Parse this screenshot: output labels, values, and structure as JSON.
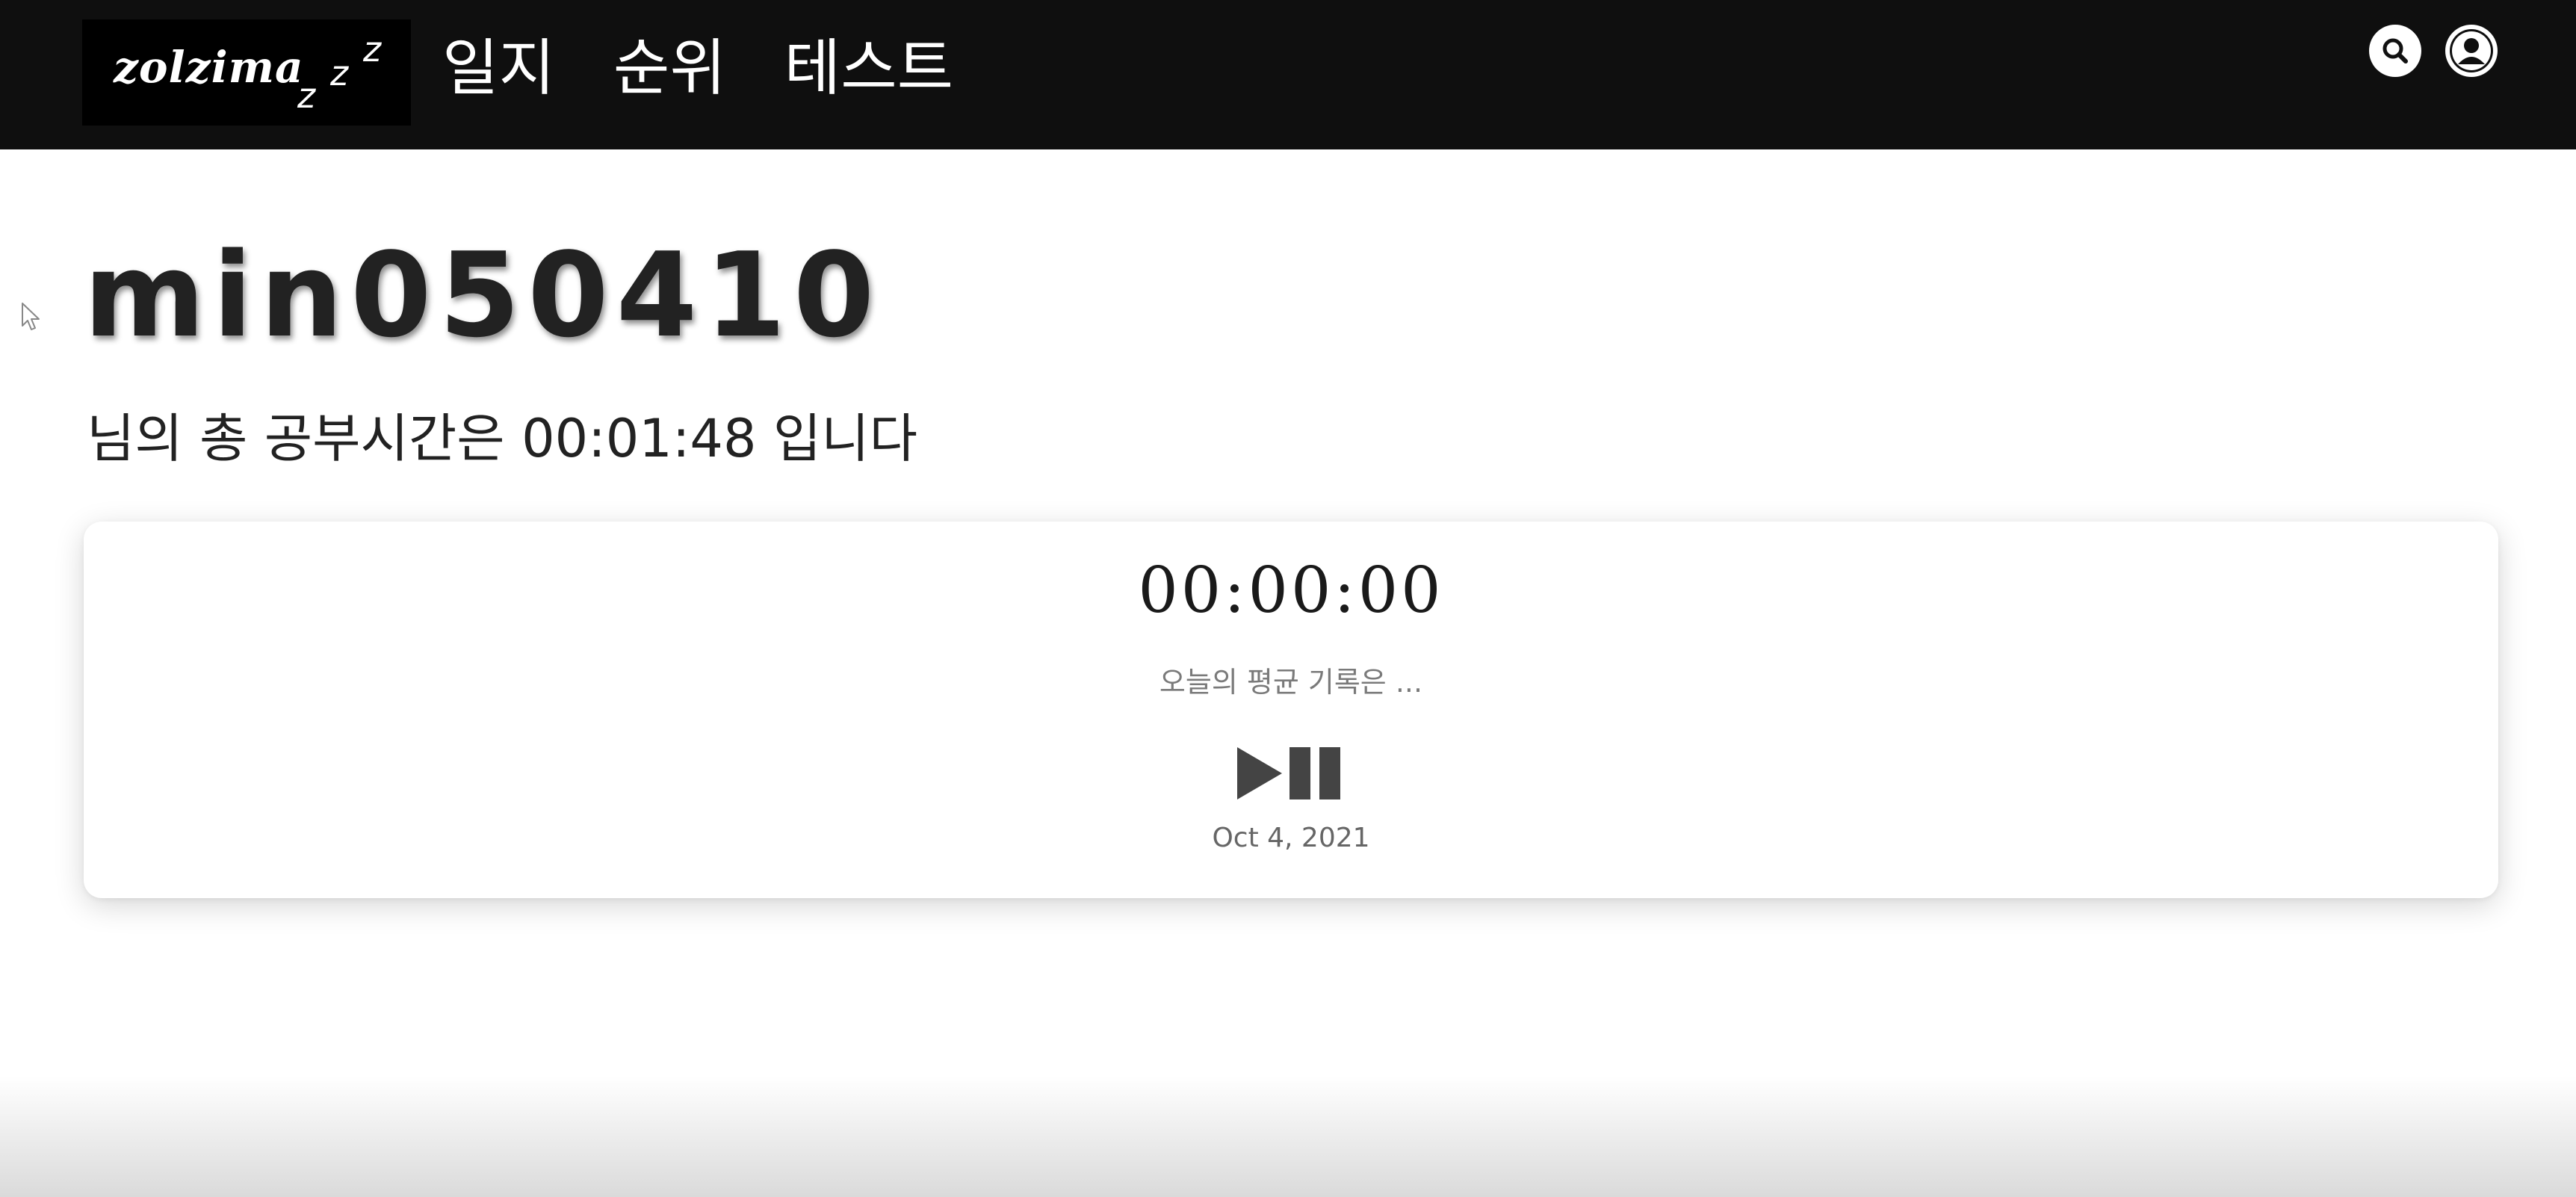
{
  "navbar": {
    "logo": {
      "text": "zolzima",
      "zzz": [
        "z",
        "z",
        "z"
      ]
    },
    "links": [
      "일지",
      "순위",
      "테스트"
    ],
    "icons": [
      "search-icon",
      "user-icon"
    ]
  },
  "profile": {
    "username": "min050410",
    "total_prefix": "님의 총 공부시간은",
    "total_time": "00:01:48",
    "total_suffix": "입니다"
  },
  "timer": {
    "display": "00:00:00",
    "average_text": "오늘의 평균 기록은 ...",
    "control_icon": "play-pause-icon",
    "date": "Oct 4, 2021"
  },
  "colors": {
    "navbar_bg": "#0f0f0f",
    "logo_bg": "#000000",
    "text_primary": "#222222",
    "card_bg": "#ffffff",
    "icon_dark": "#444444"
  }
}
